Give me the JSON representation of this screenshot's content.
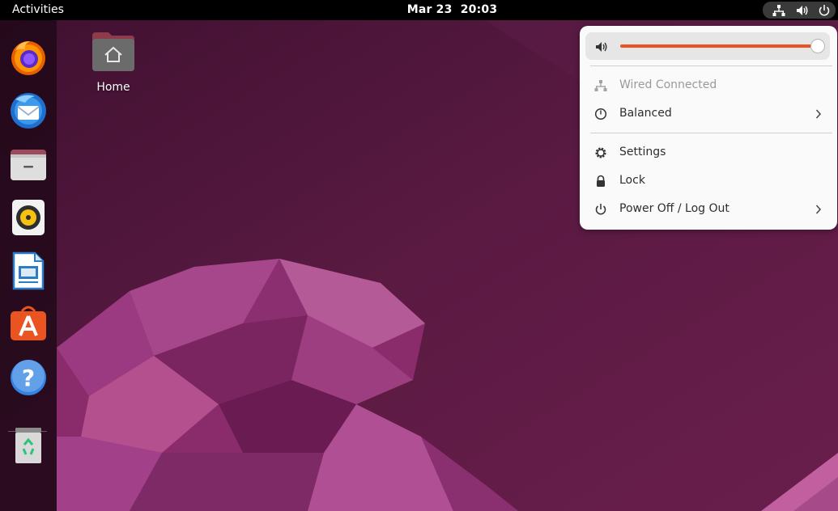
{
  "topbar": {
    "activities": "Activities",
    "date": "Mar 23",
    "time": "20:03",
    "indicators": [
      "network-icon",
      "volume-icon",
      "power-icon"
    ]
  },
  "dock": {
    "items": [
      {
        "name": "firefox",
        "icon": "firefox-icon"
      },
      {
        "name": "thunderbird",
        "icon": "thunderbird-icon"
      },
      {
        "name": "files",
        "icon": "files-icon"
      },
      {
        "name": "rhythmbox",
        "icon": "rhythmbox-icon"
      },
      {
        "name": "libreoffice-writer",
        "icon": "writer-icon"
      },
      {
        "name": "ubuntu-software",
        "icon": "software-icon"
      },
      {
        "name": "help",
        "icon": "help-icon"
      },
      {
        "name": "trash",
        "icon": "trash-icon"
      }
    ]
  },
  "desktop": {
    "home_label": "Home"
  },
  "menu": {
    "volume_level": 0.99,
    "accent": "#e95420",
    "items": [
      {
        "label": "Wired Connected",
        "icon": "network-wired-icon",
        "enabled": false
      },
      {
        "label": "Balanced",
        "icon": "power-profile-icon",
        "submenu": true
      },
      {
        "label": "Settings",
        "icon": "gear-icon"
      },
      {
        "label": "Lock",
        "icon": "lock-icon"
      },
      {
        "label": "Power Off / Log Out",
        "icon": "power-icon",
        "submenu": true
      }
    ]
  }
}
